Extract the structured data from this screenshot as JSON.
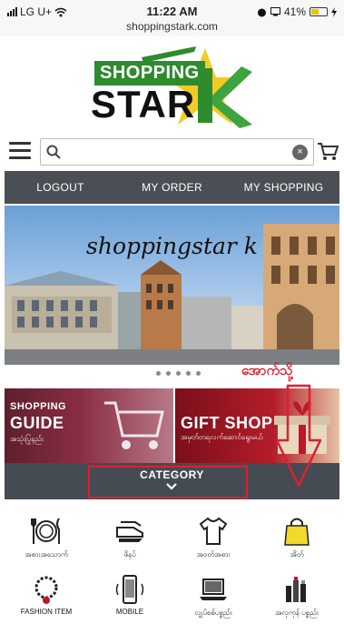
{
  "status_bar": {
    "carrier": "LG U+",
    "time": "11:22 AM",
    "battery": "41%",
    "url": "shoppingstark.com"
  },
  "logo": {
    "word1": "SHOPPING",
    "word2": "STAR"
  },
  "search": {
    "placeholder": "",
    "value": ""
  },
  "nav": {
    "items": [
      "LOGOUT",
      "MY ORDER",
      "MY SHOPPING"
    ]
  },
  "banner": {
    "title": "shoppingstar k"
  },
  "carousel": {
    "dot_count": 5
  },
  "annotation": {
    "text": "အောက်သို့"
  },
  "promos": {
    "guide": {
      "line1": "SHOPPING",
      "line2": "GUIDE",
      "line3": "အသုံးပြုနည်း"
    },
    "gift": {
      "line1": "",
      "line2": "GIFT SHOP",
      "line3": "အမှတ်တရလက်ဆောင်ရွေးမယ်"
    }
  },
  "category_bar": {
    "label": "CATEGORY"
  },
  "categories": [
    {
      "label": "အစားအသောက်",
      "icon": "dining-icon"
    },
    {
      "label": "ဖိနပ်",
      "icon": "shoe-icon"
    },
    {
      "label": "အဝတ်အစား",
      "icon": "shirt-icon"
    },
    {
      "label": "အိတ်",
      "icon": "bag-icon"
    },
    {
      "label": "FASHION ITEM",
      "icon": "necklace-icon"
    },
    {
      "label": "MOBILE",
      "icon": "mobile-icon"
    },
    {
      "label": "လျှပ်စစ်ပစ္စည်း",
      "icon": "laptop-icon"
    },
    {
      "label": "အလှကုန် ပစ္စည်း",
      "icon": "cosmetics-icon"
    }
  ],
  "colors": {
    "nav_bg": "#4a4f55",
    "category_bg": "#454b52",
    "annotation_red": "#e01e2e",
    "logo_green": "#2e8b2e"
  }
}
